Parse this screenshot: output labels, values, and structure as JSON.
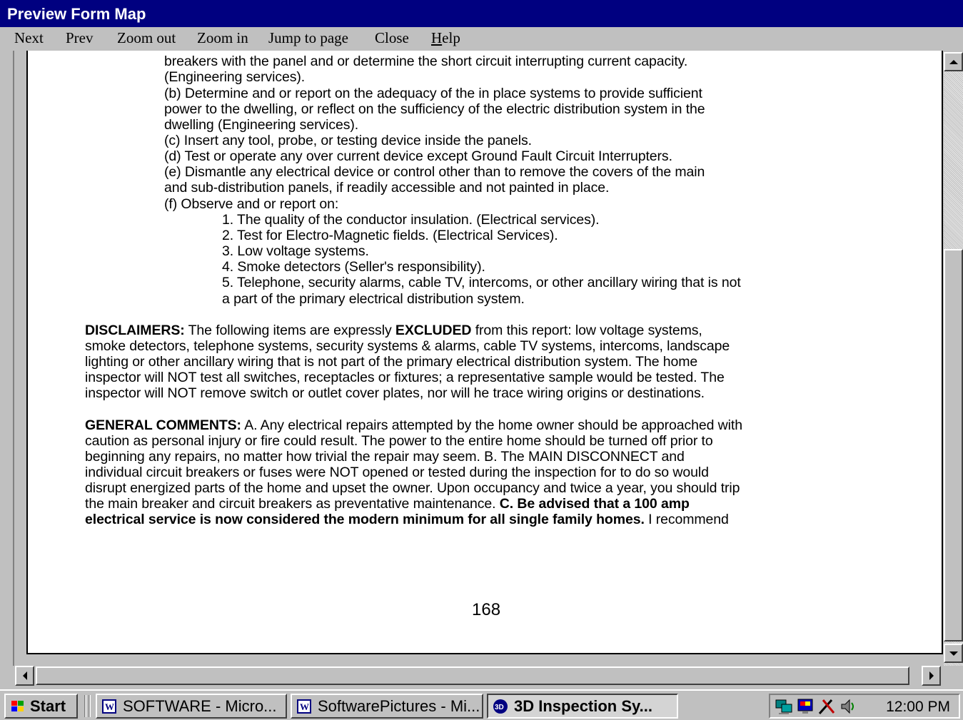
{
  "window": {
    "title": "Preview Form Map"
  },
  "menu": {
    "items": [
      {
        "label": "Next"
      },
      {
        "label": "Prev"
      },
      {
        "label": "Zoom out"
      },
      {
        "label": "Zoom in"
      },
      {
        "label": "Jump to page"
      },
      {
        "label": "Close"
      },
      {
        "label_underlined": "H",
        "label_rest": "elp"
      }
    ]
  },
  "document": {
    "lines": [
      "breakers with the panel and or determine the short circuit interrupting current capacity.",
      "(Engineering services).",
      "(b)  Determine and or report on the adequacy of the in place systems to provide sufficient",
      "power to the dwelling, or reflect on the sufficiency of the electric distribution system in the",
      "dwelling (Engineering services).",
      "(c)  Insert any tool, probe, or testing device inside the panels.",
      "(d)  Test or operate any over current device except Ground Fault Circuit Interrupters.",
      "(e)  Dismantle any electrical device or control other than to remove the covers of the main",
      "and sub-distribution panels, if readily accessible and not painted in place.",
      "(f)  Observe and or report on:",
      "1.  The quality of the conductor insulation. (Electrical services).",
      "2.  Test for Electro-Magnetic fields. (Electrical Services).",
      "3.  Low voltage systems.",
      "4.  Smoke detectors (Seller's responsibility).",
      "5.  Telephone, security alarms, cable TV, intercoms, or other ancillary wiring that is not",
      "a part of the primary electrical distribution system."
    ],
    "disclaimers": {
      "heading": "DISCLAIMERS:",
      "pre_excluded": "  The following items are expressly ",
      "excluded": "EXCLUDED",
      "post_excluded": " from this report:  low voltage systems,",
      "lines": [
        "smoke detectors, telephone systems, security systems & alarms, cable TV systems, intercoms, landscape",
        "lighting or other ancillary wiring that is not part of the primary electrical distribution system.  The home",
        "inspector will NOT test all switches, receptacles or fixtures; a representative sample would be tested.  The",
        "inspector will NOT remove switch or outlet cover plates, nor will he trace wiring origins or destinations."
      ]
    },
    "general_comments": {
      "heading": "GENERAL COMMENTS:",
      "first_line_rest": "  A.  Any electrical repairs attempted by the home owner should be approached with",
      "lines": [
        "caution as personal injury or fire could result.  The power to the entire home should be turned off prior to",
        "beginning any repairs, no matter how trivial the repair may seem.  B.  The MAIN DISCONNECT  and",
        "individual circuit breakers or fuses were NOT opened or tested during the inspection for to do so would",
        "disrupt energized parts of the home and upset the owner.  Upon occupancy and twice a year, you should trip"
      ],
      "line6_normal": "the main breaker and circuit breakers as preventative maintenance.  ",
      "line6_bold": "C.  Be advised that a 100 amp",
      "line7_bold": "electrical service is now considered the modern minimum for all single family homes.",
      "line7_normal": "  I recommend"
    },
    "page_number": "168"
  },
  "taskbar": {
    "start_label": "Start",
    "buttons": [
      {
        "label": "SOFTWARE - Micro..."
      },
      {
        "label": "SoftwarePictures - Mi..."
      },
      {
        "label": "3D Inspection Sy..."
      }
    ],
    "clock": "12:00 PM"
  },
  "colors": {
    "titlebar": "#000080",
    "chrome": "#c0c0c0",
    "page": "#ffffff"
  }
}
